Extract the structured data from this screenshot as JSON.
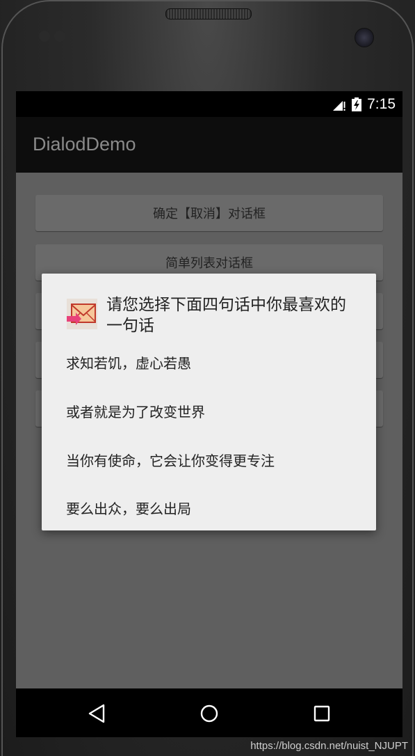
{
  "status_bar": {
    "time": "7:15",
    "icons": [
      "signal-icon",
      "battery-charging-icon"
    ]
  },
  "app_bar": {
    "title": "DialodDemo"
  },
  "buttons": [
    {
      "label": "确定【取消】对话框"
    },
    {
      "label": "简单列表对话框"
    },
    {
      "label": ""
    },
    {
      "label": ""
    },
    {
      "label": ""
    }
  ],
  "dialog": {
    "icon": "mail-icon",
    "title": "请您选择下面四句话中你最喜欢的一句话",
    "items": [
      {
        "label": "求知若饥，虚心若愚"
      },
      {
        "label": "或者就是为了改变世界"
      },
      {
        "label": "当你有使命，它会让你变得更专注"
      },
      {
        "label": "要么出众，要么出局"
      }
    ]
  },
  "nav_bar": {
    "icons": [
      "back-icon",
      "home-icon",
      "recents-icon"
    ]
  },
  "watermark": "https://blog.csdn.net/nuist_NJUPT",
  "colors": {
    "dialog_bg": "#eeeeee",
    "scrim": "#5f5f5f",
    "app_bar": "#0d0d0d",
    "title_text": "#8a8a8a"
  }
}
